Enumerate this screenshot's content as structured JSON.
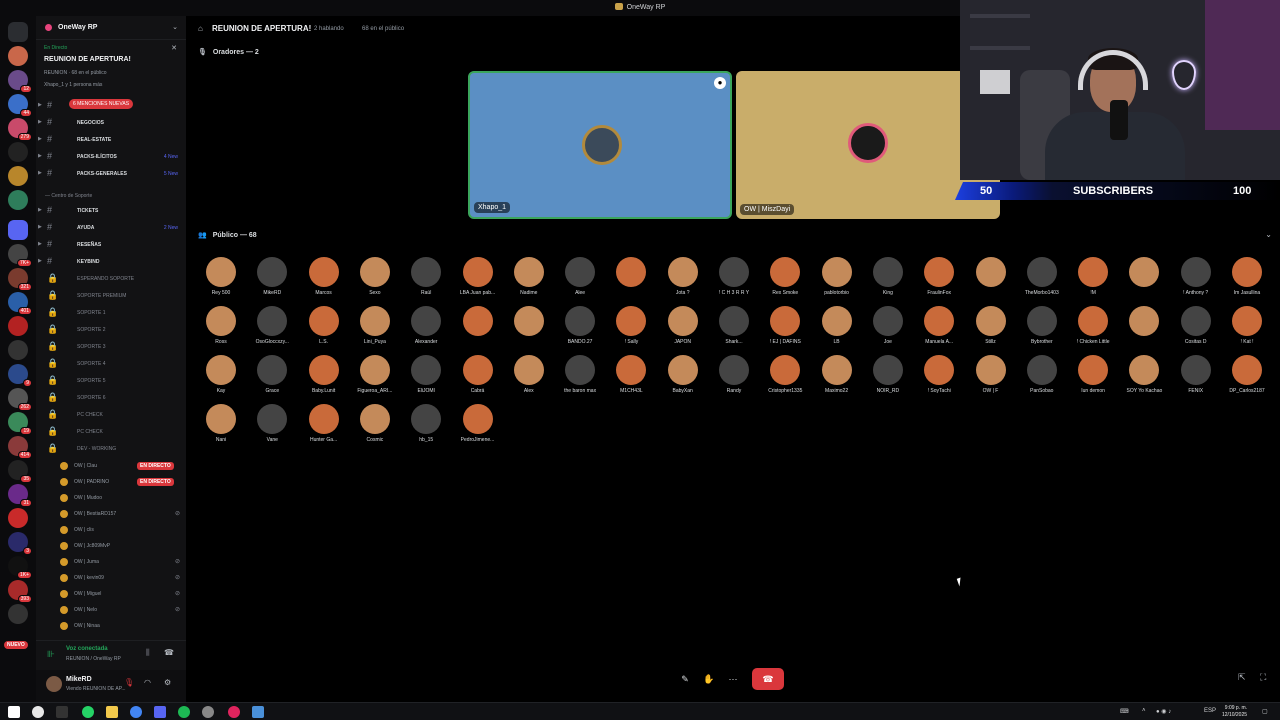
{
  "window": {
    "title": "OneWay RP"
  },
  "server": {
    "name": "OneWay RP"
  },
  "event": {
    "live_label": "En Directo",
    "title": "REUNION DE APERTURA!",
    "meta": "REUNION · 68 en el público",
    "people": "Xhapo_1 y 1 persona más"
  },
  "mentions_pill": "6 MENCIONES NUEVAS",
  "channels": [
    {
      "label": "",
      "new": ""
    },
    {
      "label": "NEGOCIOS",
      "new": ""
    },
    {
      "label": "REAL-ESTATE",
      "new": ""
    },
    {
      "label": "PACKS-ILÍCITOS",
      "new": "4 New"
    },
    {
      "label": "PACKS-GENERALES",
      "new": "5 New"
    }
  ],
  "support_category": "Centro de Soporte",
  "support_channels": [
    {
      "label": "TICKETS",
      "new": ""
    },
    {
      "label": "AYUDA",
      "new": "2 New"
    },
    {
      "label": "RESEÑAS",
      "new": ""
    },
    {
      "label": "KEYBIND",
      "new": ""
    }
  ],
  "voice_channels": [
    "ESPERANDO SOPORTE",
    "SOPORTE PREMIUM",
    "SOPORTE 1",
    "SOPORTE 2",
    "SOPORTE 3",
    "SOPORTE 4",
    "SOPORTE 5",
    "SOPORTE 6",
    "PC CHECK",
    "PC CHECK",
    "DEV - WORKING"
  ],
  "voice_users": [
    {
      "name": "OW | Clau",
      "live": "EN DIRECTO"
    },
    {
      "name": "OW | PADRINO",
      "live": "EN DIRECTO"
    },
    {
      "name": "OW | Mudoo",
      "live": ""
    },
    {
      "name": "OW | BestiaRD157",
      "live": ""
    },
    {
      "name": "OW | clis",
      "live": ""
    },
    {
      "name": "OW | Jc809MvP",
      "live": ""
    },
    {
      "name": "OW | Juma",
      "live": ""
    },
    {
      "name": "OW | kevin09",
      "live": ""
    },
    {
      "name": "OW | Miguel",
      "live": ""
    },
    {
      "name": "OW | Nelo",
      "live": ""
    },
    {
      "name": "OW | Ninaa",
      "live": ""
    }
  ],
  "voice_panel": {
    "status": "Voz conectada",
    "sub": "REUNION / OneWay RP"
  },
  "user_panel": {
    "name": "MikeRD",
    "status": "Viendo REUNION DE AP..."
  },
  "stage": {
    "title": "REUNION DE APERTURA!",
    "speaking": "2 hablando",
    "audience_meta": "68 en el público",
    "speakers_header": "Oradores — 2",
    "audience_header": "Público — 68"
  },
  "speakers": [
    {
      "name": "Xhapo_1",
      "bg": "#5b8fc4"
    },
    {
      "name": "OW | MiszDayi",
      "bg": "#c9ad6a"
    }
  ],
  "audience": [
    "Rey 500",
    "MikeRD",
    "Marcos",
    "Sexo",
    "Raúl",
    "LBA Juan pab...",
    "Nadime",
    "Alee",
    "",
    "Jota ?",
    "! C H 3 R R Y",
    "Rex Smoke",
    "pablotorbio",
    "King",
    "FraulinFox",
    "",
    "TheMorbo1403",
    "!M",
    "",
    "! Anthony ?",
    "Im Jasullina",
    "Ross",
    "OsoGloccxzy...",
    "L.S.",
    "Lini_Puya",
    "Alexander",
    "",
    "",
    "BANDO.27",
    "! Sally",
    "JAPON",
    "Shark...",
    "! EJ | DAFINS",
    "LB",
    "Joe",
    "Manuela A...",
    "Stillz",
    "Bybrother",
    "! Chicken Little",
    "",
    "Cositas D",
    "! Kat !",
    "Kay",
    "Grace",
    "Baby.Lunit",
    "Figueroa_ARI...",
    "EliJOMI",
    "Cabrá",
    "Alex",
    "the baron max",
    "M1CH43L",
    "BabyXan",
    "Randy",
    "Cristopher1335",
    "Maximo22",
    "NOIR_RD",
    "! SoyTachi",
    "OW | F",
    "PanSobao",
    "Iun demon",
    "SOY Yo Kachao",
    "FENIX",
    "DP_Carlos2187",
    "Nani",
    "Vane",
    "Hunter Ga...",
    "Cosmic",
    "hb_15",
    "PedroJimene..."
  ],
  "overlay": {
    "subs_current": "50",
    "subs_label": "SUBSCRIBERS",
    "subs_goal": "100",
    "subs_progress": 0.5
  },
  "taskbar": {
    "lang": "ESP",
    "time": "9:09 p. m.",
    "date": "12/10/2025"
  },
  "colors": {
    "accent": "#5865f2",
    "danger": "#da373c",
    "online": "#23a55a"
  }
}
